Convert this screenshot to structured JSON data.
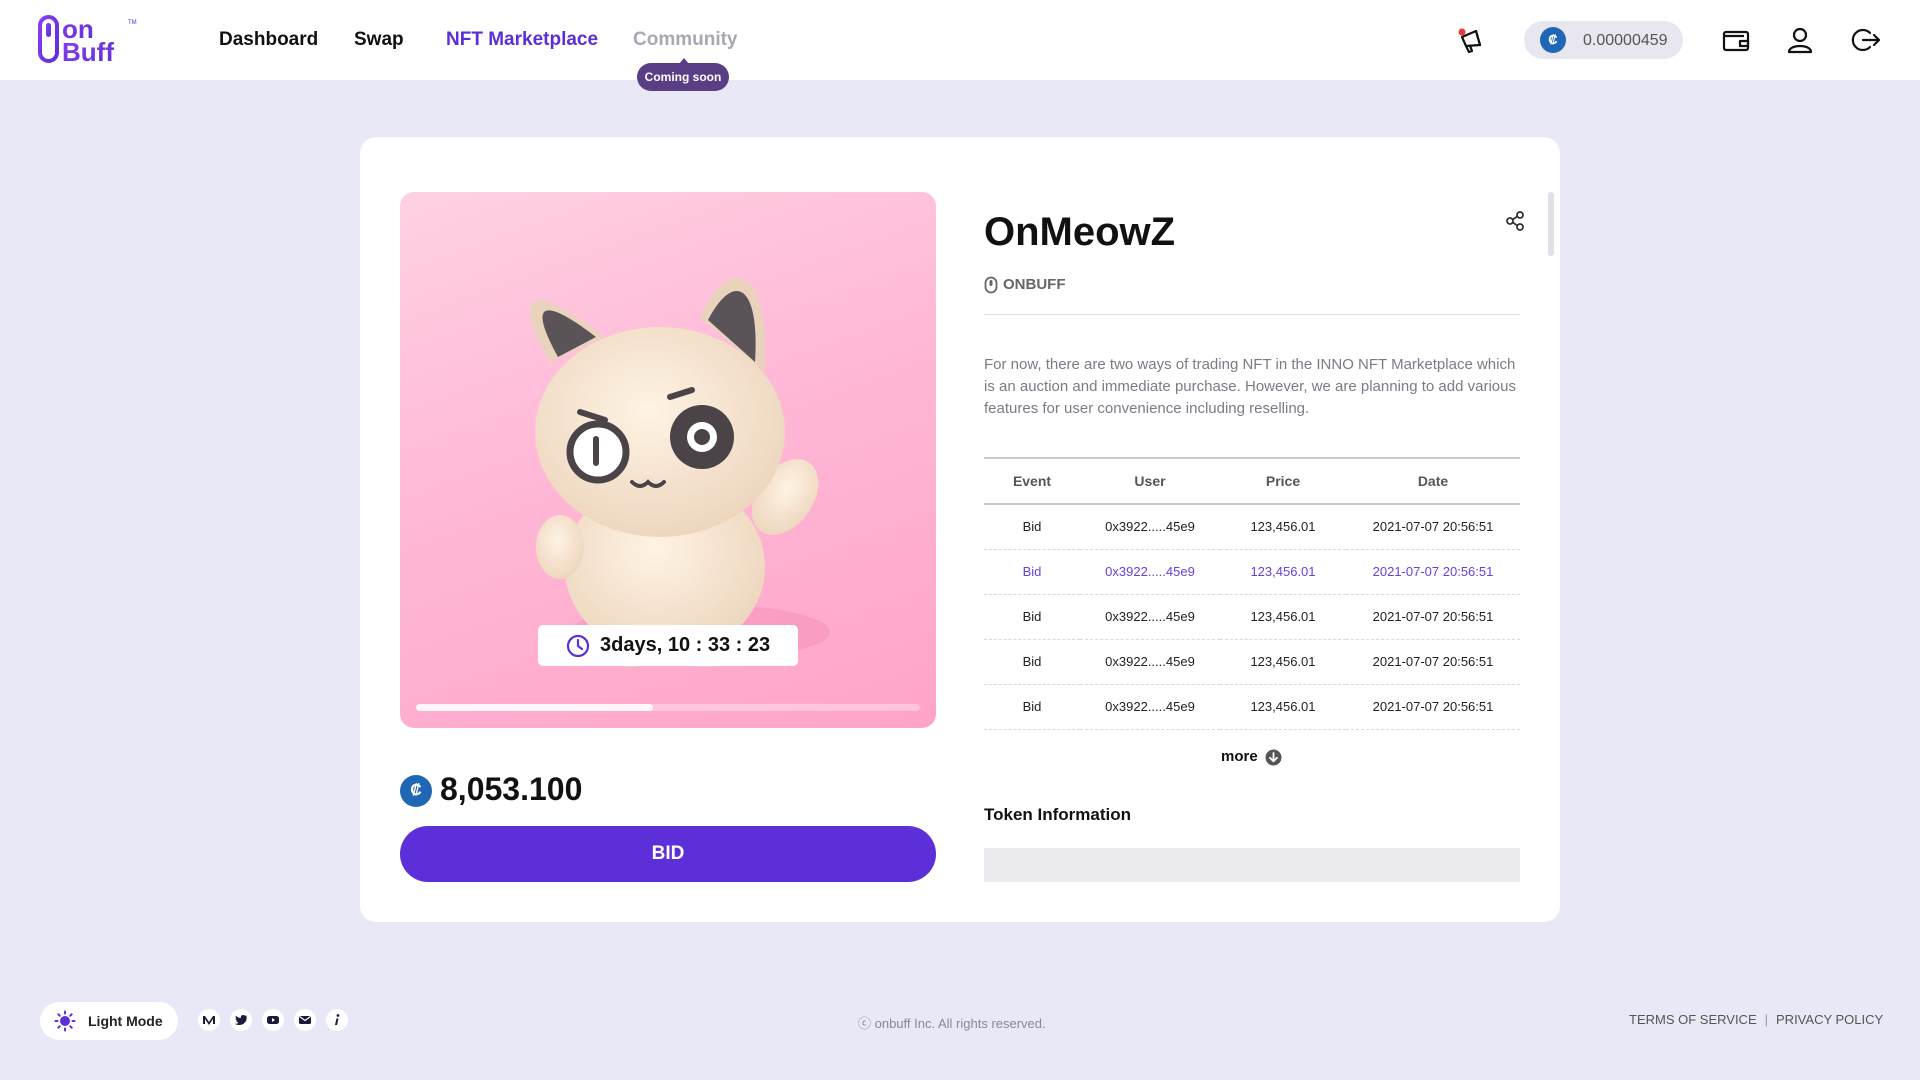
{
  "brand": {
    "name": "onbuff",
    "primary_color": "#5d2fd9",
    "accent_color": "#1f66b5"
  },
  "nav": {
    "items": [
      {
        "label": "Dashboard",
        "state": "default"
      },
      {
        "label": "Swap",
        "state": "default"
      },
      {
        "label": "NFT Marketplace",
        "state": "active"
      },
      {
        "label": "Community",
        "state": "disabled"
      }
    ],
    "community_badge": "Coming soon"
  },
  "header": {
    "coin_symbol": "₡",
    "balance": "0.00000459",
    "icons": [
      "megaphone-icon",
      "wallet-icon",
      "user-icon",
      "logout-icon"
    ]
  },
  "nft": {
    "title": "OnMeowZ",
    "creator": "ONBUFF",
    "description": "For now, there are two ways of trading NFT in the INNO NFT Marketplace which is an auction and immediate purchase. However, we are planning to add various features for user convenience including reselling.",
    "timer": "3days, 10 : 33 : 23",
    "auction_progress_percent": 47,
    "price": "8,053.100",
    "coin_symbol": "₡",
    "bid_label": "BID"
  },
  "history": {
    "columns": [
      "Event",
      "User",
      "Price",
      "Date"
    ],
    "rows": [
      {
        "event": "Bid",
        "user": "0x3922.....45e9",
        "price": "123,456.01",
        "date": "2021-07-07 20:56:51",
        "highlight": false
      },
      {
        "event": "Bid",
        "user": "0x3922.....45e9",
        "price": "123,456.01",
        "date": "2021-07-07 20:56:51",
        "highlight": true
      },
      {
        "event": "Bid",
        "user": "0x3922.....45e9",
        "price": "123,456.01",
        "date": "2021-07-07 20:56:51",
        "highlight": false
      },
      {
        "event": "Bid",
        "user": "0x3922.....45e9",
        "price": "123,456.01",
        "date": "2021-07-07 20:56:51",
        "highlight": false
      },
      {
        "event": "Bid",
        "user": "0x3922.....45e9",
        "price": "123,456.01",
        "date": "2021-07-07 20:56:51",
        "highlight": false
      }
    ],
    "more_label": "more"
  },
  "token_info": {
    "title": "Token Information"
  },
  "footer": {
    "mode_label": "Light Mode",
    "social_icons": [
      "medium-icon",
      "twitter-icon",
      "youtube-icon",
      "mail-icon",
      "info-icon"
    ],
    "copyright": "ⓒ onbuff Inc. All rights reserved.",
    "terms": "TERMS OF SERVICE",
    "privacy": "PRIVACY POLICY"
  }
}
